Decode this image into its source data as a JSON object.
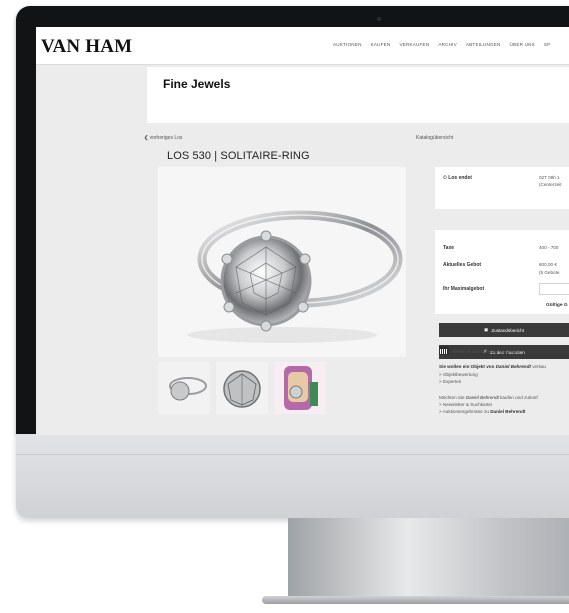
{
  "site": {
    "logo": "VAN HAM"
  },
  "nav": [
    "AUKTIONEN",
    "KAUFEN",
    "VERKAUFEN",
    "ARCHIV",
    "ABTEILUNGEN",
    "ÜBER UNS",
    "SP"
  ],
  "department": {
    "title": "Fine Jewels"
  },
  "subnav": {
    "prev": "vorheriges Los",
    "catalog": "Katalogübersicht"
  },
  "lot": {
    "title": "LOS 530 | SOLITAIRE-RING"
  },
  "auction_info": {
    "ends_label": "Los endet",
    "ends_value": "02T 09h 1",
    "ends_tz": "(Centerzeit",
    "estimate_label": "Taxe",
    "estimate_value": "400 - 700",
    "current_bid_label": "Aktuelles Gebot",
    "current_bid_value": "600,00 €",
    "bids_count": "(5 Gebote",
    "max_bid_label": "Ihr Maximalgebot",
    "valid_label": "Gültige G"
  },
  "buttons": {
    "condition_report": "Zustandsbericht",
    "favorites": "Zu den Favoriten"
  },
  "calendar": {
    "label": "Termin in den Kalender eintragen"
  },
  "seller_section": {
    "line1_prefix": "Sie wollen ein Objekt von",
    "line1_artist": "Daniel Behrendt",
    "line1_suffix": "verkau",
    "link1": "> Objektbewertung",
    "link2": "> Experten",
    "line2_prefix": "Möchten Sie",
    "line2_artist": "Daniel Behrendt",
    "line2_suffix": "kaufen und zukünf",
    "link3": "> Newsletter & Suchkartei",
    "link4_prefix": "> Auktionsergebnisse zu",
    "link4_artist": "Daniel Behrendt"
  },
  "icons": [
    "chevron-left-icon",
    "clock-icon",
    "document-icon",
    "star-icon",
    "calendar-icon"
  ]
}
